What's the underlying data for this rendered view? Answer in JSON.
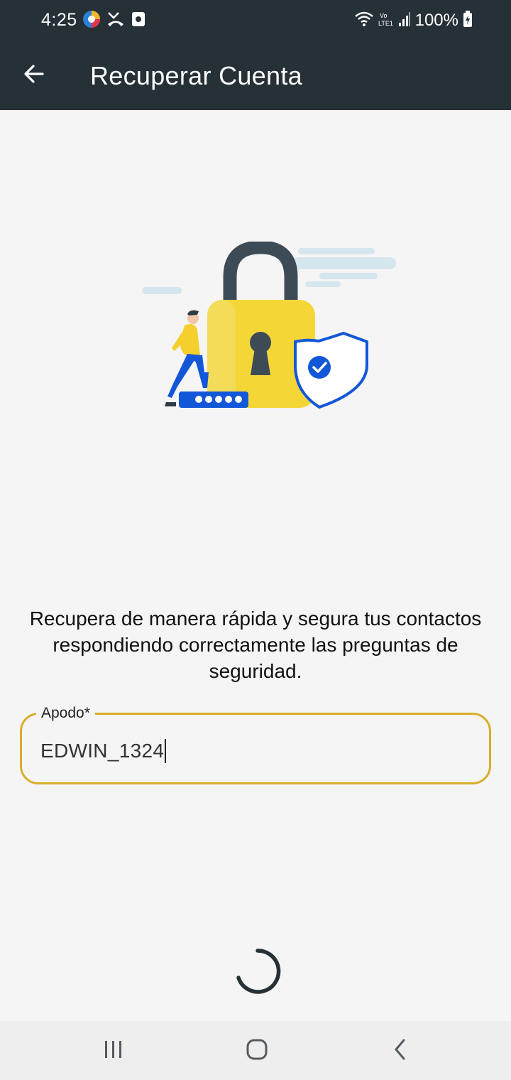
{
  "status_bar": {
    "time": "4:25",
    "battery": "100%",
    "left_icons": [
      "app-icon",
      "missed-call-icon",
      "screenshot-icon"
    ],
    "right_icons": [
      "wifi-icon",
      "volte-icon",
      "signal-icon",
      "battery-charging-icon"
    ]
  },
  "app_bar": {
    "title": "Recuperar Cuenta",
    "back_icon": "arrow-back-icon",
    "background": "#263037"
  },
  "illustration": {
    "icons": [
      "padlock-icon",
      "shield-check-icon",
      "person-icon",
      "password-field-icon",
      "cloud-icon"
    ]
  },
  "description": "Recupera de manera rápida y segura tus contactos respondiendo correctamente las preguntas de seguridad.",
  "form": {
    "nickname": {
      "label": "Apodo*",
      "value": "EDWIN_1324",
      "border_color": "#d8ae2a"
    }
  },
  "loading": {
    "icon": "spinner-icon"
  },
  "nav_bar": {
    "buttons": [
      "recent-apps",
      "home",
      "back"
    ]
  }
}
